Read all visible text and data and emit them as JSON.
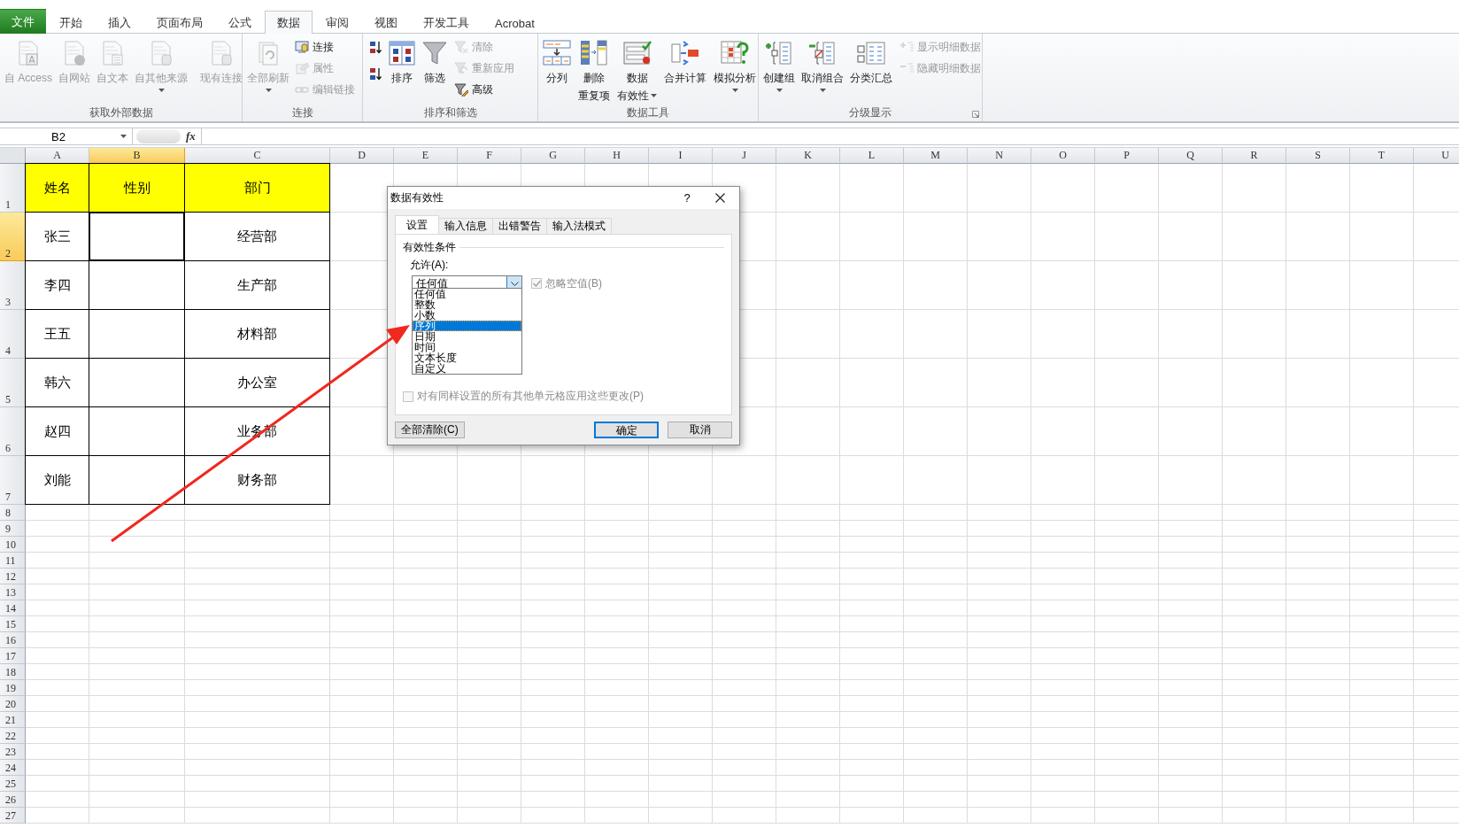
{
  "ribbon_tabs": [
    {
      "label": "文件",
      "kind": "file",
      "selected": false
    },
    {
      "label": "开始",
      "kind": "tab",
      "selected": false
    },
    {
      "label": "插入",
      "kind": "tab",
      "selected": false
    },
    {
      "label": "页面布局",
      "kind": "tab",
      "selected": false
    },
    {
      "label": "公式",
      "kind": "tab",
      "selected": false
    },
    {
      "label": "数据",
      "kind": "tab",
      "selected": true
    },
    {
      "label": "审阅",
      "kind": "tab",
      "selected": false
    },
    {
      "label": "视图",
      "kind": "tab",
      "selected": false
    },
    {
      "label": "开发工具",
      "kind": "tab",
      "selected": false
    },
    {
      "label": "Acrobat",
      "kind": "tab",
      "selected": false
    }
  ],
  "ribbon_groups": [
    {
      "title": "获取外部数据",
      "launcher": false,
      "commands": [
        {
          "label": "自 Access",
          "kind": "large",
          "disabled": true,
          "dropdown": false
        },
        {
          "label": "自网站",
          "kind": "large",
          "disabled": true,
          "dropdown": false
        },
        {
          "label": "自文本",
          "kind": "large",
          "disabled": true,
          "dropdown": false
        },
        {
          "label": "自其他来源",
          "kind": "large",
          "disabled": true,
          "dropdown": true
        },
        {
          "label": "现有连接",
          "kind": "large",
          "disabled": true,
          "dropdown": false
        }
      ]
    },
    {
      "title": "连接",
      "launcher": false,
      "commands": [
        {
          "label": "全部刷新",
          "kind": "large",
          "disabled": true,
          "dropdown": true
        },
        {
          "label": "连接",
          "kind": "small",
          "disabled": false,
          "dropdown": false
        },
        {
          "label": "属性",
          "kind": "small",
          "disabled": true,
          "dropdown": false
        },
        {
          "label": "编辑链接",
          "kind": "small",
          "disabled": true,
          "dropdown": false
        }
      ]
    },
    {
      "title": "排序和筛选",
      "launcher": false,
      "commands": [
        {
          "kind": "icon",
          "disabled": false,
          "dropdown": false
        },
        {
          "kind": "icon",
          "disabled": false,
          "dropdown": false
        },
        {
          "label": "排序",
          "kind": "large",
          "disabled": false,
          "dropdown": false
        },
        {
          "label": "筛选",
          "kind": "large",
          "disabled": false,
          "dropdown": false
        },
        {
          "label": "清除",
          "kind": "small",
          "disabled": true,
          "dropdown": false
        },
        {
          "label": "重新应用",
          "kind": "small",
          "disabled": true,
          "dropdown": false
        },
        {
          "label": "高级",
          "kind": "small",
          "disabled": false,
          "dropdown": false
        }
      ]
    },
    {
      "title": "数据工具",
      "launcher": false,
      "commands": [
        {
          "label": "分列",
          "kind": "large",
          "disabled": false,
          "dropdown": false
        },
        {
          "lines": [
            "删除",
            "重复项"
          ],
          "kind": "large",
          "disabled": false,
          "dropdown": false
        },
        {
          "lines": [
            "数据",
            "有效性"
          ],
          "kind": "large",
          "disabled": false,
          "dropdown": true
        },
        {
          "label": "合并计算",
          "kind": "large",
          "disabled": false,
          "dropdown": false
        },
        {
          "label": "模拟分析",
          "kind": "large",
          "disabled": false,
          "dropdown": true
        }
      ]
    },
    {
      "title": "分级显示",
      "launcher": true,
      "commands": [
        {
          "label": "创建组",
          "kind": "large",
          "disabled": false,
          "dropdown": true
        },
        {
          "label": "取消组合",
          "kind": "large",
          "disabled": false,
          "dropdown": true
        },
        {
          "label": "分类汇总",
          "kind": "large",
          "disabled": false,
          "dropdown": false
        },
        {
          "label": "显示明细数据",
          "kind": "small",
          "disabled": true,
          "dropdown": false
        },
        {
          "label": "隐藏明细数据",
          "kind": "small",
          "disabled": true,
          "dropdown": false
        }
      ]
    }
  ],
  "formula_bar": {
    "name_box": "B2",
    "function_button": "fx"
  },
  "sheet": {
    "columns": [
      {
        "label": "A",
        "selected": false
      },
      {
        "label": "B",
        "selected": true
      },
      {
        "label": "C",
        "selected": false
      },
      {
        "label": "D",
        "selected": false
      },
      {
        "label": "E",
        "selected": false
      },
      {
        "label": "F",
        "selected": false
      },
      {
        "label": "G",
        "selected": false
      },
      {
        "label": "H",
        "selected": false
      },
      {
        "label": "I",
        "selected": false
      },
      {
        "label": "J",
        "selected": false
      },
      {
        "label": "K",
        "selected": false
      },
      {
        "label": "L",
        "selected": false
      },
      {
        "label": "M",
        "selected": false
      },
      {
        "label": "N",
        "selected": false
      },
      {
        "label": "O",
        "selected": false
      },
      {
        "label": "P",
        "selected": false
      },
      {
        "label": "Q",
        "selected": false
      },
      {
        "label": "R",
        "selected": false
      },
      {
        "label": "S",
        "selected": false
      },
      {
        "label": "T",
        "selected": false
      },
      {
        "label": "U",
        "selected": false
      }
    ],
    "rows": [
      {
        "number": "1",
        "selected": false,
        "highlighted": true,
        "cells": [
          {
            "text": "姓名",
            "active": false
          },
          {
            "text": "性别",
            "active": false
          },
          {
            "text": "部门",
            "active": false
          }
        ]
      },
      {
        "number": "2",
        "selected": true,
        "highlighted": false,
        "cells": [
          {
            "text": "张三",
            "active": false
          },
          {
            "active": true
          },
          {
            "text": "经营部",
            "active": false
          }
        ]
      },
      {
        "number": "3",
        "selected": false,
        "highlighted": false,
        "cells": [
          {
            "text": "李四",
            "active": false
          },
          {
            "active": false
          },
          {
            "text": "生产部",
            "active": false
          }
        ]
      },
      {
        "number": "4",
        "selected": false,
        "highlighted": false,
        "cells": [
          {
            "text": "王五",
            "active": false
          },
          {
            "active": false
          },
          {
            "text": "材料部",
            "active": false
          }
        ]
      },
      {
        "number": "5",
        "selected": false,
        "highlighted": false,
        "cells": [
          {
            "text": "韩六",
            "active": false
          },
          {
            "active": false
          },
          {
            "text": "办公室",
            "active": false
          }
        ]
      },
      {
        "number": "6",
        "selected": false,
        "highlighted": false,
        "cells": [
          {
            "text": "赵四",
            "active": false
          },
          {
            "active": false
          },
          {
            "text": "业务部",
            "active": false
          }
        ]
      },
      {
        "number": "7",
        "selected": false,
        "highlighted": false,
        "cells": [
          {
            "text": "刘能",
            "active": false
          },
          {
            "active": false
          },
          {
            "text": "财务部",
            "active": false
          }
        ]
      },
      {
        "number": "8",
        "selected": false
      },
      {
        "number": "9",
        "selected": false
      },
      {
        "number": "10",
        "selected": false
      },
      {
        "number": "11",
        "selected": false
      },
      {
        "number": "12",
        "selected": false
      },
      {
        "number": "13",
        "selected": false
      },
      {
        "number": "14",
        "selected": false
      },
      {
        "number": "15",
        "selected": false
      },
      {
        "number": "16",
        "selected": false
      },
      {
        "number": "17",
        "selected": false
      },
      {
        "number": "18",
        "selected": false
      },
      {
        "number": "19",
        "selected": false
      },
      {
        "number": "20",
        "selected": false
      },
      {
        "number": "21",
        "selected": false
      },
      {
        "number": "22",
        "selected": false
      },
      {
        "number": "23",
        "selected": false
      },
      {
        "number": "24",
        "selected": false
      },
      {
        "number": "25",
        "selected": false
      },
      {
        "number": "26",
        "selected": false
      },
      {
        "number": "27",
        "selected": false
      }
    ]
  },
  "dialog": {
    "title": "数据有效性",
    "help": "?",
    "tabs": [
      {
        "label": "设置",
        "selected": true
      },
      {
        "label": "输入信息",
        "selected": false
      },
      {
        "label": "出错警告",
        "selected": false
      },
      {
        "label": "输入法模式",
        "selected": false
      }
    ],
    "section": "有效性条件",
    "allow_label": "允许(A):",
    "allow_value": "任何值",
    "options": [
      {
        "label": "任何值",
        "selected": false
      },
      {
        "label": "整数",
        "selected": false
      },
      {
        "label": "小数",
        "selected": false
      },
      {
        "label": "序列",
        "selected": true
      },
      {
        "label": "日期",
        "selected": false
      },
      {
        "label": "时间",
        "selected": false
      },
      {
        "label": "文本长度",
        "selected": false
      },
      {
        "label": "自定义",
        "selected": false
      }
    ],
    "ignore_blank": {
      "label": "忽略空值(B)",
      "checked": true,
      "disabled": true
    },
    "apply_all": {
      "label": "对有同样设置的所有其他单元格应用这些更改(P)",
      "checked": false,
      "disabled": true
    },
    "buttons": [
      {
        "label": "全部清除(C)",
        "kind": "left"
      },
      {
        "label": "确定",
        "kind": "default"
      },
      {
        "label": "取消",
        "kind": "normal"
      }
    ]
  }
}
